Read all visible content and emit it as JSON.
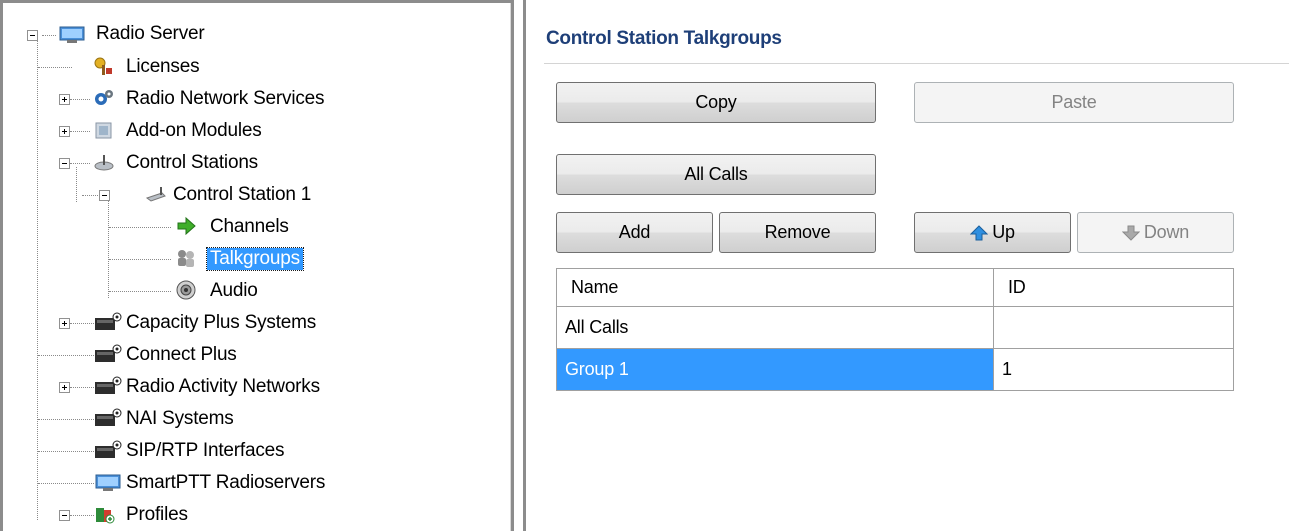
{
  "tree": {
    "items": [
      {
        "label": "Radio Server",
        "icon": "server-icon",
        "expander": "minus"
      },
      {
        "label": "Licenses",
        "icon": "license-icon",
        "expander": ""
      },
      {
        "label": "Radio Network Services",
        "icon": "network-services-icon",
        "expander": "plus"
      },
      {
        "label": "Add-on Modules",
        "icon": "modules-icon",
        "expander": "plus"
      },
      {
        "label": "Control Stations",
        "icon": "control-stations-icon",
        "expander": "minus"
      },
      {
        "label": "Control Station 1",
        "icon": "control-station-icon",
        "expander": "minus"
      },
      {
        "label": "Channels",
        "icon": "channels-arrow-icon",
        "expander": ""
      },
      {
        "label": "Talkgroups",
        "icon": "talkgroups-icon",
        "expander": "",
        "selected": true
      },
      {
        "label": "Audio",
        "icon": "audio-speaker-icon",
        "expander": ""
      },
      {
        "label": "Capacity Plus Systems",
        "icon": "capacity-plus-icon",
        "expander": "plus"
      },
      {
        "label": "Connect Plus",
        "icon": "connect-plus-icon",
        "expander": ""
      },
      {
        "label": "Radio Activity Networks",
        "icon": "radio-activity-icon",
        "expander": "plus"
      },
      {
        "label": "NAI Systems",
        "icon": "nai-systems-icon",
        "expander": ""
      },
      {
        "label": "SIP/RTP Interfaces",
        "icon": "sip-rtp-icon",
        "expander": ""
      },
      {
        "label": "SmartPTT Radioservers",
        "icon": "radioservers-icon",
        "expander": ""
      },
      {
        "label": "Profiles",
        "icon": "profiles-icon",
        "expander": "minus"
      }
    ]
  },
  "panel": {
    "title": "Control Station Talkgroups",
    "buttons": {
      "copy": "Copy",
      "paste": "Paste",
      "all_calls": "All Calls",
      "add": "Add",
      "remove": "Remove",
      "up": "Up",
      "down": "Down"
    },
    "table": {
      "columns": [
        "Name",
        "ID"
      ],
      "rows": [
        {
          "name": "All Calls",
          "id": ""
        },
        {
          "name": "Group 1",
          "id": "1",
          "selected": true
        }
      ]
    }
  },
  "colors": {
    "selection": "#3399ff",
    "title": "#1e3f78"
  }
}
